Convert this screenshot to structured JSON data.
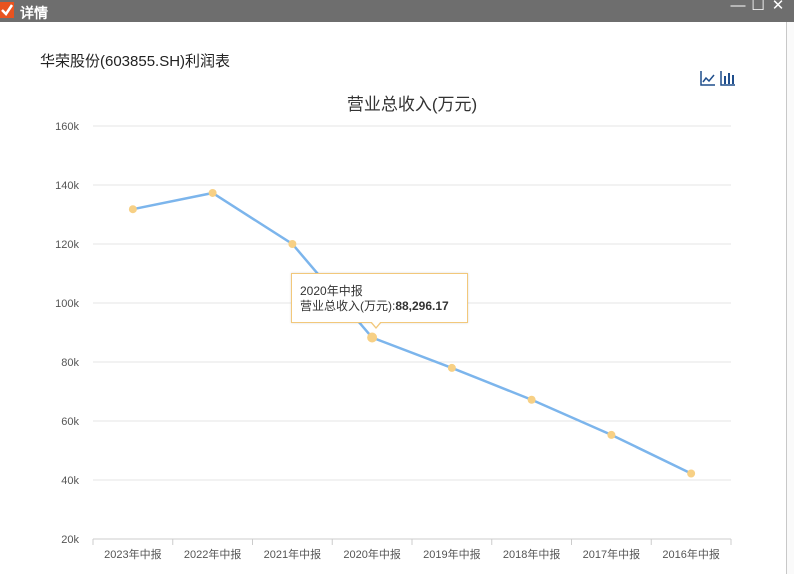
{
  "window": {
    "title": "详情",
    "minimize": "—",
    "maximize": "☐",
    "close": "✕"
  },
  "report": {
    "title": "华荣股份(603855.SH)利润表"
  },
  "tooltip": {
    "period": "2020年中报",
    "label": "营业总收入(万元):",
    "value": "88,296.17"
  },
  "icons": {
    "line_chart": "line-chart-icon",
    "bar_chart": "bar-chart-icon",
    "check": "check-icon"
  },
  "colors": {
    "line": "#7cb5ec",
    "point": "#f7d085",
    "accent": "#e8531f"
  },
  "chart_data": {
    "type": "line",
    "title": "营业总收入(万元)",
    "categories": [
      "2023年中报",
      "2022年中报",
      "2021年中报",
      "2020年中报",
      "2019年中报",
      "2018年中报",
      "2017年中报",
      "2016年中报"
    ],
    "series": [
      {
        "values": [
          131800,
          137300,
          120000,
          88296.17,
          78000,
          67200,
          55300,
          42200
        ]
      }
    ],
    "yticks": [
      "160k",
      "140k",
      "120k",
      "100k",
      "80k",
      "60k",
      "40k",
      "20k"
    ],
    "ylim": [
      20000,
      160000
    ],
    "grid": true
  }
}
